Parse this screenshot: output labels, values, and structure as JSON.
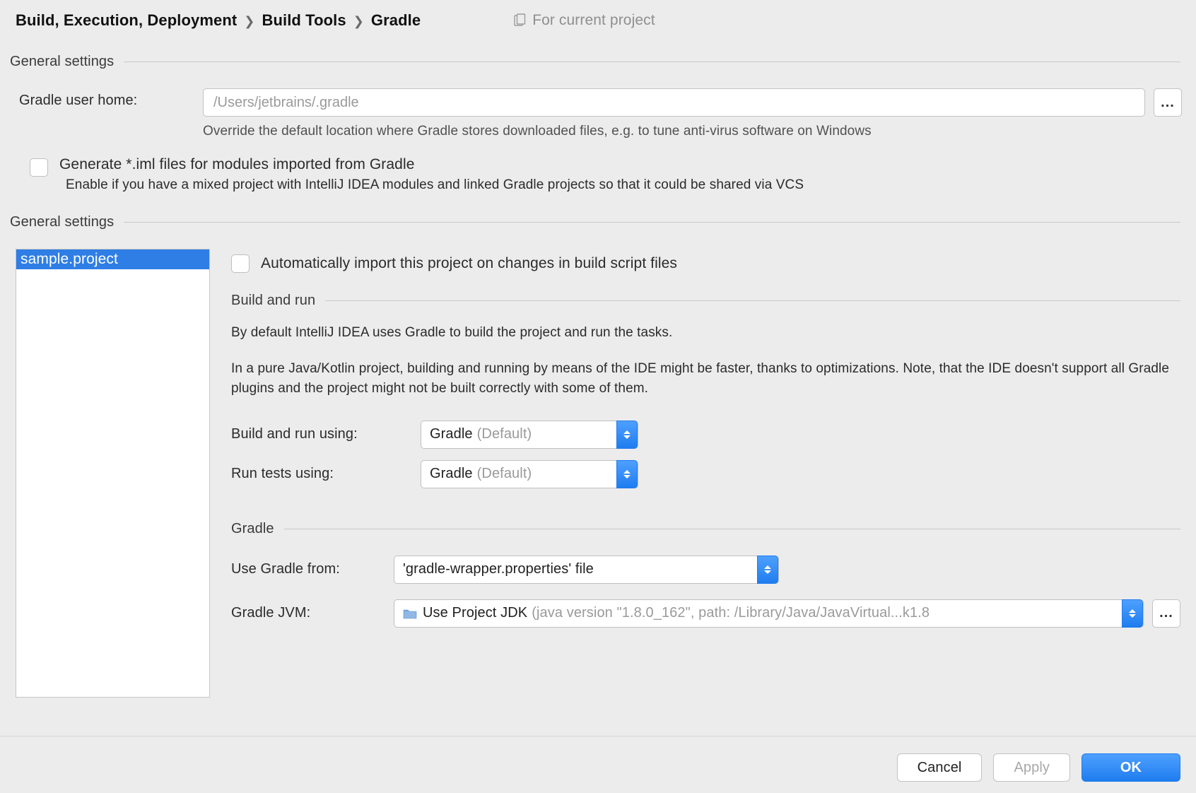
{
  "breadcrumb": {
    "items": [
      "Build, Execution, Deployment",
      "Build Tools",
      "Gradle"
    ],
    "scope": "For current project"
  },
  "sections": {
    "general1": "General settings",
    "general2": "General settings",
    "build_run": "Build and run",
    "gradle": "Gradle"
  },
  "gradle_home": {
    "label": "Gradle user home:",
    "placeholder": "/Users/jetbrains/.gradle",
    "help": "Override the default location where Gradle stores downloaded files, e.g. to tune anti-virus software on Windows",
    "browse": "..."
  },
  "generate_iml": {
    "label": "Generate *.iml files for modules imported from Gradle",
    "help": "Enable if you have a mixed project with IntelliJ IDEA modules and linked Gradle projects so that it could be shared via VCS"
  },
  "project_list": {
    "items": [
      "sample.project"
    ]
  },
  "auto_import": {
    "label": "Automatically import this project on changes in build script files"
  },
  "build_run_info": {
    "p1": "By default IntelliJ IDEA uses Gradle to build the project and run the tasks.",
    "p2": "In a pure Java/Kotlin project, building and running by means of the IDE might be faster, thanks to optimizations. Note, that the IDE doesn't support all Gradle plugins and the project might not be built correctly with some of them."
  },
  "build_run_using": {
    "label": "Build and run using:",
    "value": "Gradle",
    "suffix": "(Default)"
  },
  "run_tests_using": {
    "label": "Run tests using:",
    "value": "Gradle",
    "suffix": "(Default)"
  },
  "use_gradle_from": {
    "label": "Use Gradle from:",
    "value": "'gradle-wrapper.properties' file"
  },
  "gradle_jvm": {
    "label": "Gradle JVM:",
    "value": "Use Project JDK",
    "suffix": "(java version \"1.8.0_162\", path: /Library/Java/JavaVirtual...k1.8",
    "browse": "..."
  },
  "footer": {
    "cancel": "Cancel",
    "apply": "Apply",
    "ok": "OK"
  }
}
